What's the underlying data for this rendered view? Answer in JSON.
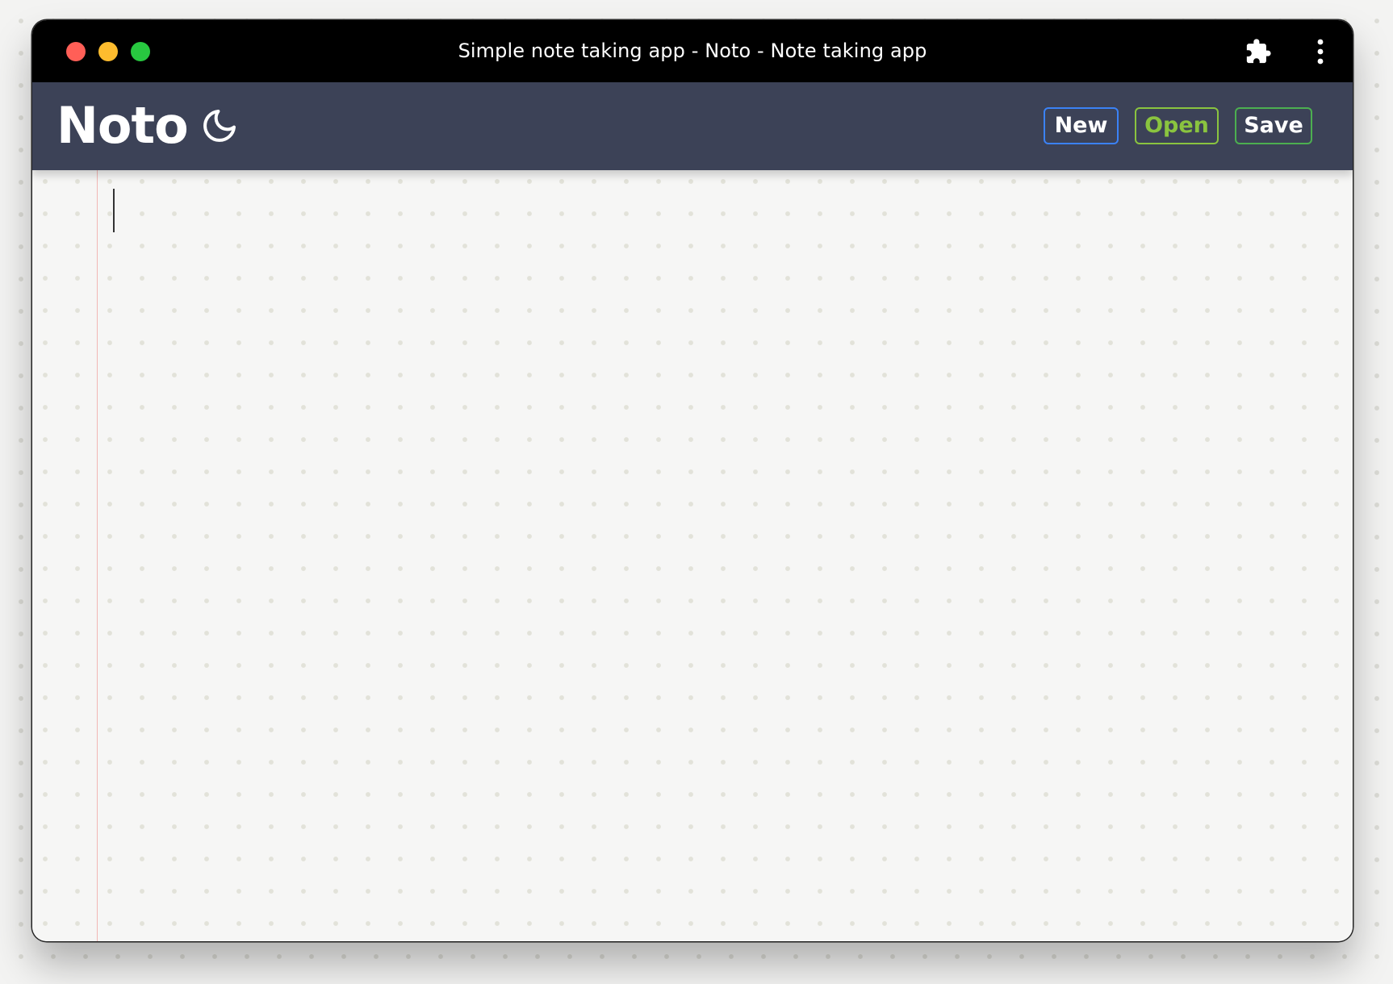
{
  "window": {
    "title": "Simple note taking app - Noto - Note taking app",
    "traffic_lights": {
      "close_color": "#ff5f57",
      "minimize_color": "#febc2e",
      "maximize_color": "#28c840"
    },
    "extension_icon": "puzzle-piece-icon",
    "menu_icon": "vertical-ellipsis-icon"
  },
  "header": {
    "logo": "Noto",
    "theme_toggle_icon": "crescent-moon-icon",
    "background_color": "#3c4257",
    "buttons": {
      "new_label": "New",
      "open_label": "Open",
      "save_label": "Save"
    },
    "button_colors": {
      "new": "#3b82f6",
      "open": "#8ac43f",
      "save": "#4caf50"
    }
  },
  "editor": {
    "content": "",
    "margin_line_color": "#f2b7b5"
  }
}
